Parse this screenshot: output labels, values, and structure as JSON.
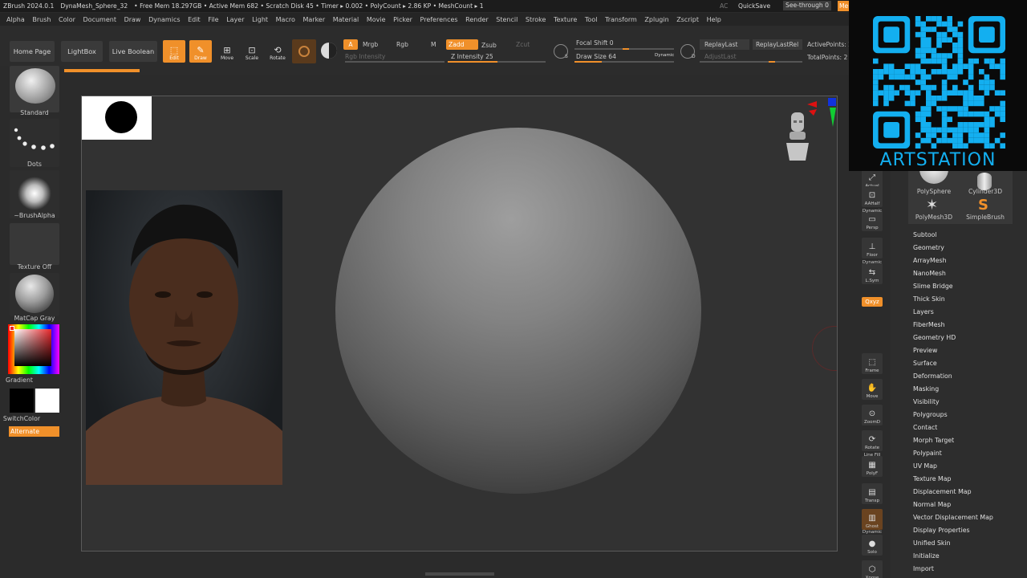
{
  "titlebar": {
    "app": "ZBrush 2024.0.1",
    "document": "DynaMesh_Sphere_32",
    "stats": "• Free Mem 18.297GB • Active Mem 682 • Scratch Disk 45 • Timer ▸ 0.002 • PolyCount ▸ 2.86 KP • MeshCount ▸ 1",
    "ac": "AC",
    "quicksave": "QuickSave",
    "see_through": "See-through  0",
    "menus_short": "Me"
  },
  "menu": [
    "Alpha",
    "Brush",
    "Color",
    "Document",
    "Draw",
    "Dynamics",
    "Edit",
    "File",
    "Layer",
    "Light",
    "Macro",
    "Marker",
    "Material",
    "Movie",
    "Picker",
    "Preferences",
    "Render",
    "Stencil",
    "Stroke",
    "Texture",
    "Tool",
    "Transform",
    "Zplugin",
    "Zscript",
    "Help"
  ],
  "toolbar": {
    "home_page": "Home Page",
    "lightbox": "LightBox",
    "live_boolean": "Live Boolean",
    "edit": "Edit",
    "draw": "Draw",
    "move": "Move",
    "scale": "Scale",
    "rotate": "Rotate",
    "a": "A",
    "mrgb": "Mrgb",
    "rgb": "Rgb",
    "m": "M",
    "rgb_intensity": "Rgb Intensity",
    "zadd": "Zadd",
    "zsub": "Zsub",
    "zcut": "Zcut",
    "z_intensity": "Z Intensity 25",
    "z_intensity_value": 25,
    "focal_shift": "Focal Shift 0",
    "draw_size": "Draw Size 64",
    "draw_size_value": 64,
    "dynamic": "Dynamic",
    "s_label": "S",
    "d_label": "D",
    "replay_last": "ReplayLast",
    "replay_last_rel": "ReplayLastRel",
    "adjust_last": "AdjustLast",
    "active_points": "ActivePoints: 2",
    "total_points": "TotalPoints: 2"
  },
  "leftshelf": {
    "brush": "Standard",
    "stroke": "Dots",
    "alpha": "~BrushAlpha",
    "texture": "Texture Off",
    "material": "MatCap Gray",
    "gradient": "Gradient",
    "switch_color": "SwitchColor",
    "alternate": "Alternate"
  },
  "rightstrip": [
    "Actual",
    "AAHalf",
    "Persp",
    "Floor",
    "L.Sym",
    "Qxyz",
    "Frame",
    "Move",
    "ZoomD",
    "Rotate",
    "PolyF",
    "Transp",
    "Ghost",
    "Solo",
    "Xpose"
  ],
  "rightstrip_tags": {
    "dynamic": "Dynamic",
    "line_fill": "Line Fill"
  },
  "tools": [
    "PolySphere",
    "Cylinder3D",
    "PolyMesh3D",
    "SimpleBrush"
  ],
  "subtool_menu": [
    "Subtool",
    "Geometry",
    "ArrayMesh",
    "NanoMesh",
    "Slime Bridge",
    "Thick Skin",
    "Layers",
    "FiberMesh",
    "Geometry HD",
    "Preview",
    "Surface",
    "Deformation",
    "Masking",
    "Visibility",
    "Polygroups",
    "Contact",
    "Morph Target",
    "Polypaint",
    "UV Map",
    "Texture Map",
    "Displacement Map",
    "Normal Map",
    "Vector Displacement Map",
    "Display Properties",
    "Unified Skin",
    "Initialize",
    "Import"
  ],
  "watermark": "ARTSTATION",
  "colors": {
    "accent": "#f0902a",
    "artstation_blue": "#13aff0",
    "bg": "#2b2b2b"
  }
}
